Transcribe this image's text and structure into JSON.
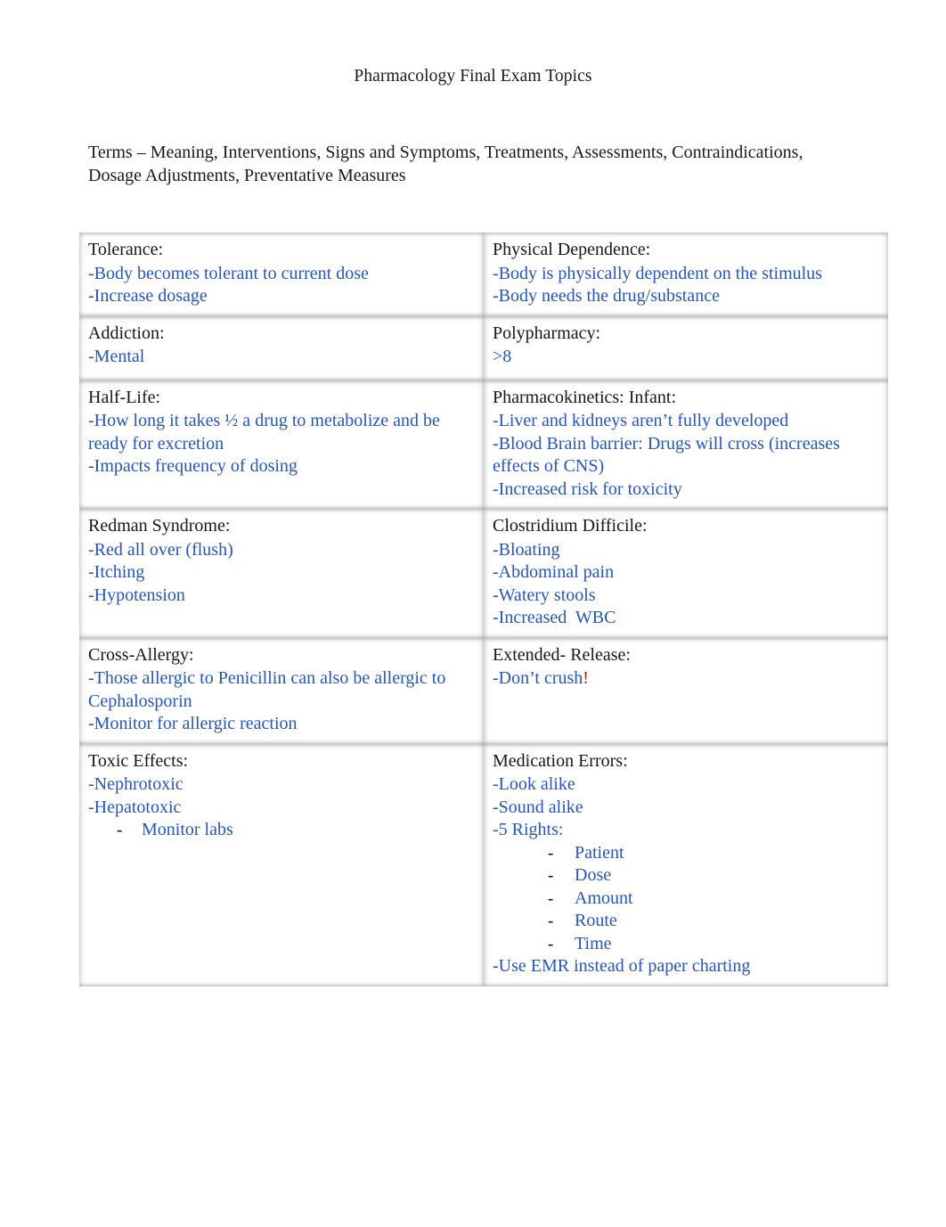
{
  "document": {
    "title": "Pharmacology Final Exam Topics",
    "intro": "Terms – Meaning, Interventions, Signs and Symptoms, Treatments, Assessments, Contraindications, Dosage Adjustments, Preventative Measures"
  },
  "colors": {
    "term_text": "#171717",
    "detail_text": "#2356c0",
    "emphasis": "#d01414",
    "cell_rule": "#969696",
    "page_background": "#ffffff"
  },
  "table": {
    "columns": 2,
    "rows": [
      {
        "left": {
          "term": "Tolerance:",
          "lines": [
            "-Body becomes tolerant to current dose",
            "-Increase dosage"
          ]
        },
        "right": {
          "term": "Physical Dependence:",
          "lines": [
            "-Body is physically dependent on the stimulus",
            "-Body needs the drug/substance"
          ]
        }
      },
      {
        "left": {
          "term": "Addiction:",
          "lines": [
            "-Mental"
          ]
        },
        "right": {
          "term": "Polypharmacy:",
          "lines": [
            ">8"
          ]
        }
      },
      {
        "left": {
          "term": "Half-Life:",
          "lines": [
            "-How long it takes ½ a drug to metabolize and be ready for excretion",
            "-Impacts frequency of dosing"
          ]
        },
        "right": {
          "term": "Pharmacokinetics: Infant:",
          "lines": [
            "-Liver and kidneys aren’t fully developed",
            "-Blood Brain barrier: Drugs will cross (increases effects of CNS)",
            "-Increased risk for toxicity"
          ]
        }
      },
      {
        "left": {
          "term": "Redman Syndrome:",
          "lines": [
            "-Red all over (flush)",
            "-Itching",
            "-Hypotension"
          ]
        },
        "right": {
          "term": "Clostridium Difficile:",
          "lines": [
            "-Bloating",
            "-Abdominal pain",
            "-Watery stools",
            "-Increased  WBC"
          ]
        }
      },
      {
        "left": {
          "term": "Cross-Allergy:",
          "lines": [
            "-Those allergic to Penicillin can also be allergic to Cephalosporin",
            "-Monitor for allergic reaction"
          ]
        },
        "right": {
          "term": "Extended- Release:",
          "lines": [
            "-Don’t crush"
          ],
          "emphasis_suffix": "!"
        }
      },
      {
        "left": {
          "term": "Toxic Effects:",
          "lines": [
            "-Nephrotoxic",
            "-Hepatotoxic"
          ],
          "sub_bullets": [
            "Monitor labs"
          ]
        },
        "right": {
          "term": "Medication Errors:",
          "lines": [
            "-Look alike",
            "-Sound alike",
            "-5 Rights:"
          ],
          "rights_bullets": [
            "Patient",
            "Dose",
            "Amount",
            "Route",
            "Time"
          ],
          "trailing_lines": [
            "-Use EMR instead of paper charting"
          ]
        }
      }
    ]
  }
}
